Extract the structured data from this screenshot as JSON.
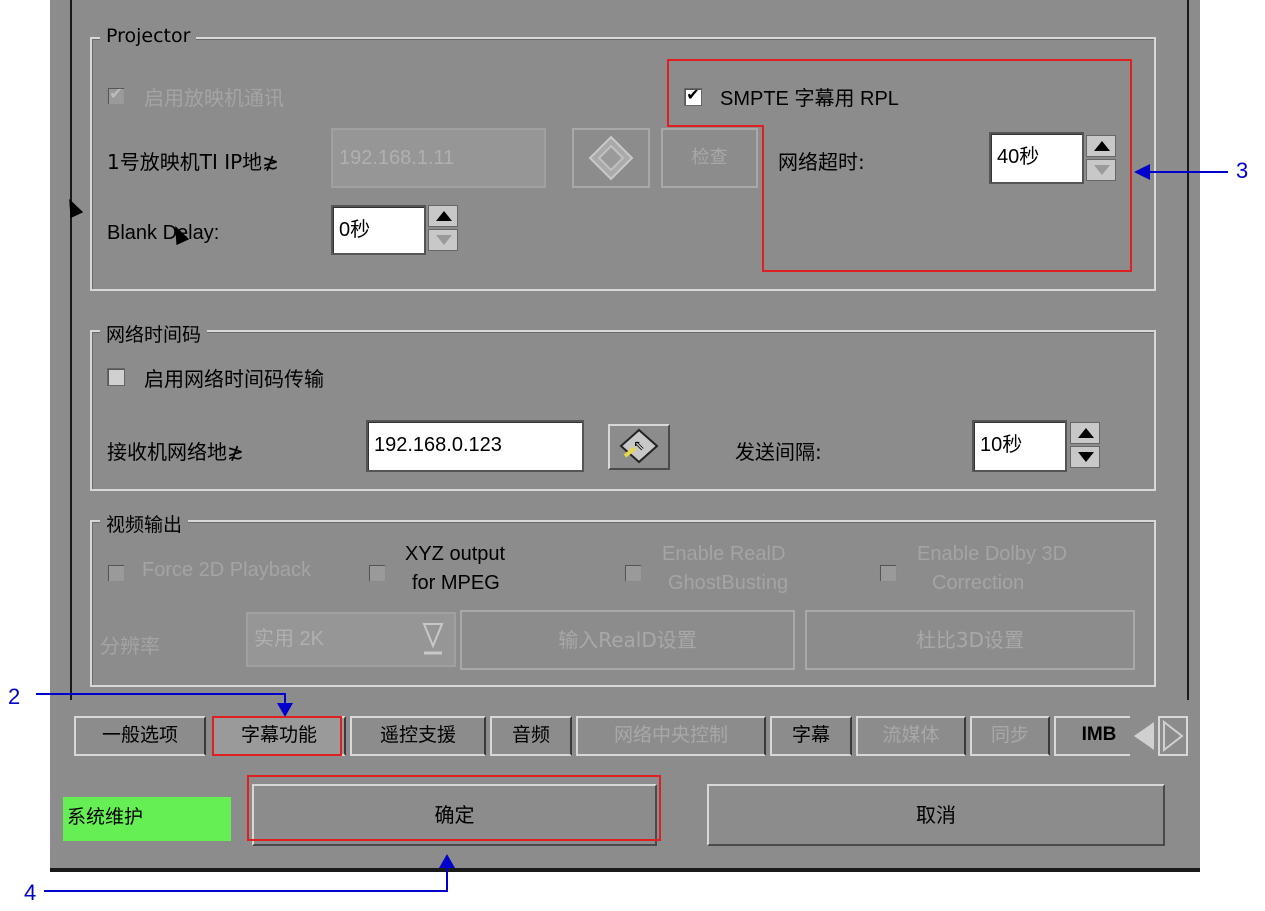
{
  "projector": {
    "title": "Projector",
    "enable_comm_label": "启用放映机通讯",
    "enable_comm_checked": true,
    "ip_label": "1号放映机TI IP地≵",
    "ip_value": "192.168.1.11",
    "check_button": "检查",
    "blank_delay_label": "Blank Delay:",
    "blank_delay_value": "0秒",
    "smpte_label": "SMPTE 字幕用 RPL",
    "smpte_checked": true,
    "timeout_label": "网络超时:",
    "timeout_value": "40秒"
  },
  "timecode": {
    "title": "网络时间码",
    "enable_label": "启用网络时间码传输",
    "enable_checked": false,
    "receiver_label": "接收机网络地≵",
    "receiver_value": "192.168.0.123",
    "interval_label": "发送间隔:",
    "interval_value": "10秒"
  },
  "video": {
    "title": "视频输出",
    "force2d_label": "Force 2D Playback",
    "xyz_label_line1": "XYZ output",
    "xyz_label_line2": "for MPEG",
    "reald_label_line1": "Enable RealD",
    "reald_label_line2": "GhostBusting",
    "dolby_label_line1": "Enable Dolby 3D",
    "dolby_label_line2": "Correction",
    "resolution_label": "分辨率",
    "resolution_value": "实用 2K",
    "reald_button": "输入RealD设置",
    "dolby_button": "杜比3D设置"
  },
  "tabs": [
    {
      "label": "一般选项"
    },
    {
      "label": "字幕功能"
    },
    {
      "label": "遥控支援"
    },
    {
      "label": "音频"
    },
    {
      "label": "网络中央控制"
    },
    {
      "label": "字幕"
    },
    {
      "label": "流媒体"
    },
    {
      "label": "同步"
    },
    {
      "label": "IMB"
    }
  ],
  "footer": {
    "status_label": "系统维护",
    "status_color": "#66ee55",
    "ok_button": "确定",
    "cancel_button": "取消"
  },
  "callouts": {
    "c2": "2",
    "c3": "3",
    "c4": "4"
  },
  "colors": {
    "highlight_red": "#e02020",
    "callout_blue": "#0000cc",
    "window_gray": "#8c8c8c"
  }
}
